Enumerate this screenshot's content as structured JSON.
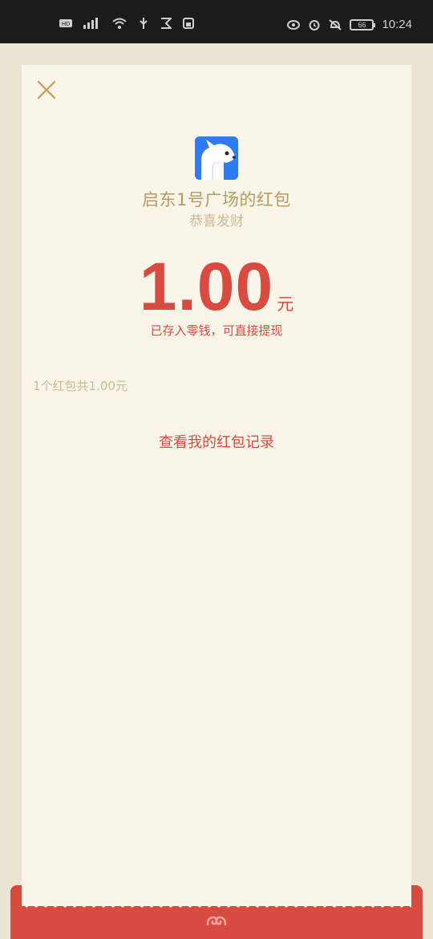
{
  "status_bar": {
    "time": "10:24",
    "battery": "66",
    "left_icons": [
      "hd-icon",
      "signal-icon",
      "wifi-icon",
      "usb-icon",
      "notification-icon",
      "sim-icon"
    ],
    "right_icons": [
      "eye-icon",
      "alarm-icon",
      "mute-icon"
    ]
  },
  "red_packet": {
    "sender_title": "启东1号广场的红包",
    "wish": "恭喜发财",
    "amount": "1.00",
    "unit": "元",
    "stored_note": "已存入零钱，可直接提现",
    "summary": "1个红包共1.00元",
    "records_link": "查看我的红包记录"
  },
  "colors": {
    "accent_red": "#d94b41",
    "gold_text": "#b89a62",
    "paper": "#faf5e9",
    "avatar_blue": "#2f7cf2"
  }
}
